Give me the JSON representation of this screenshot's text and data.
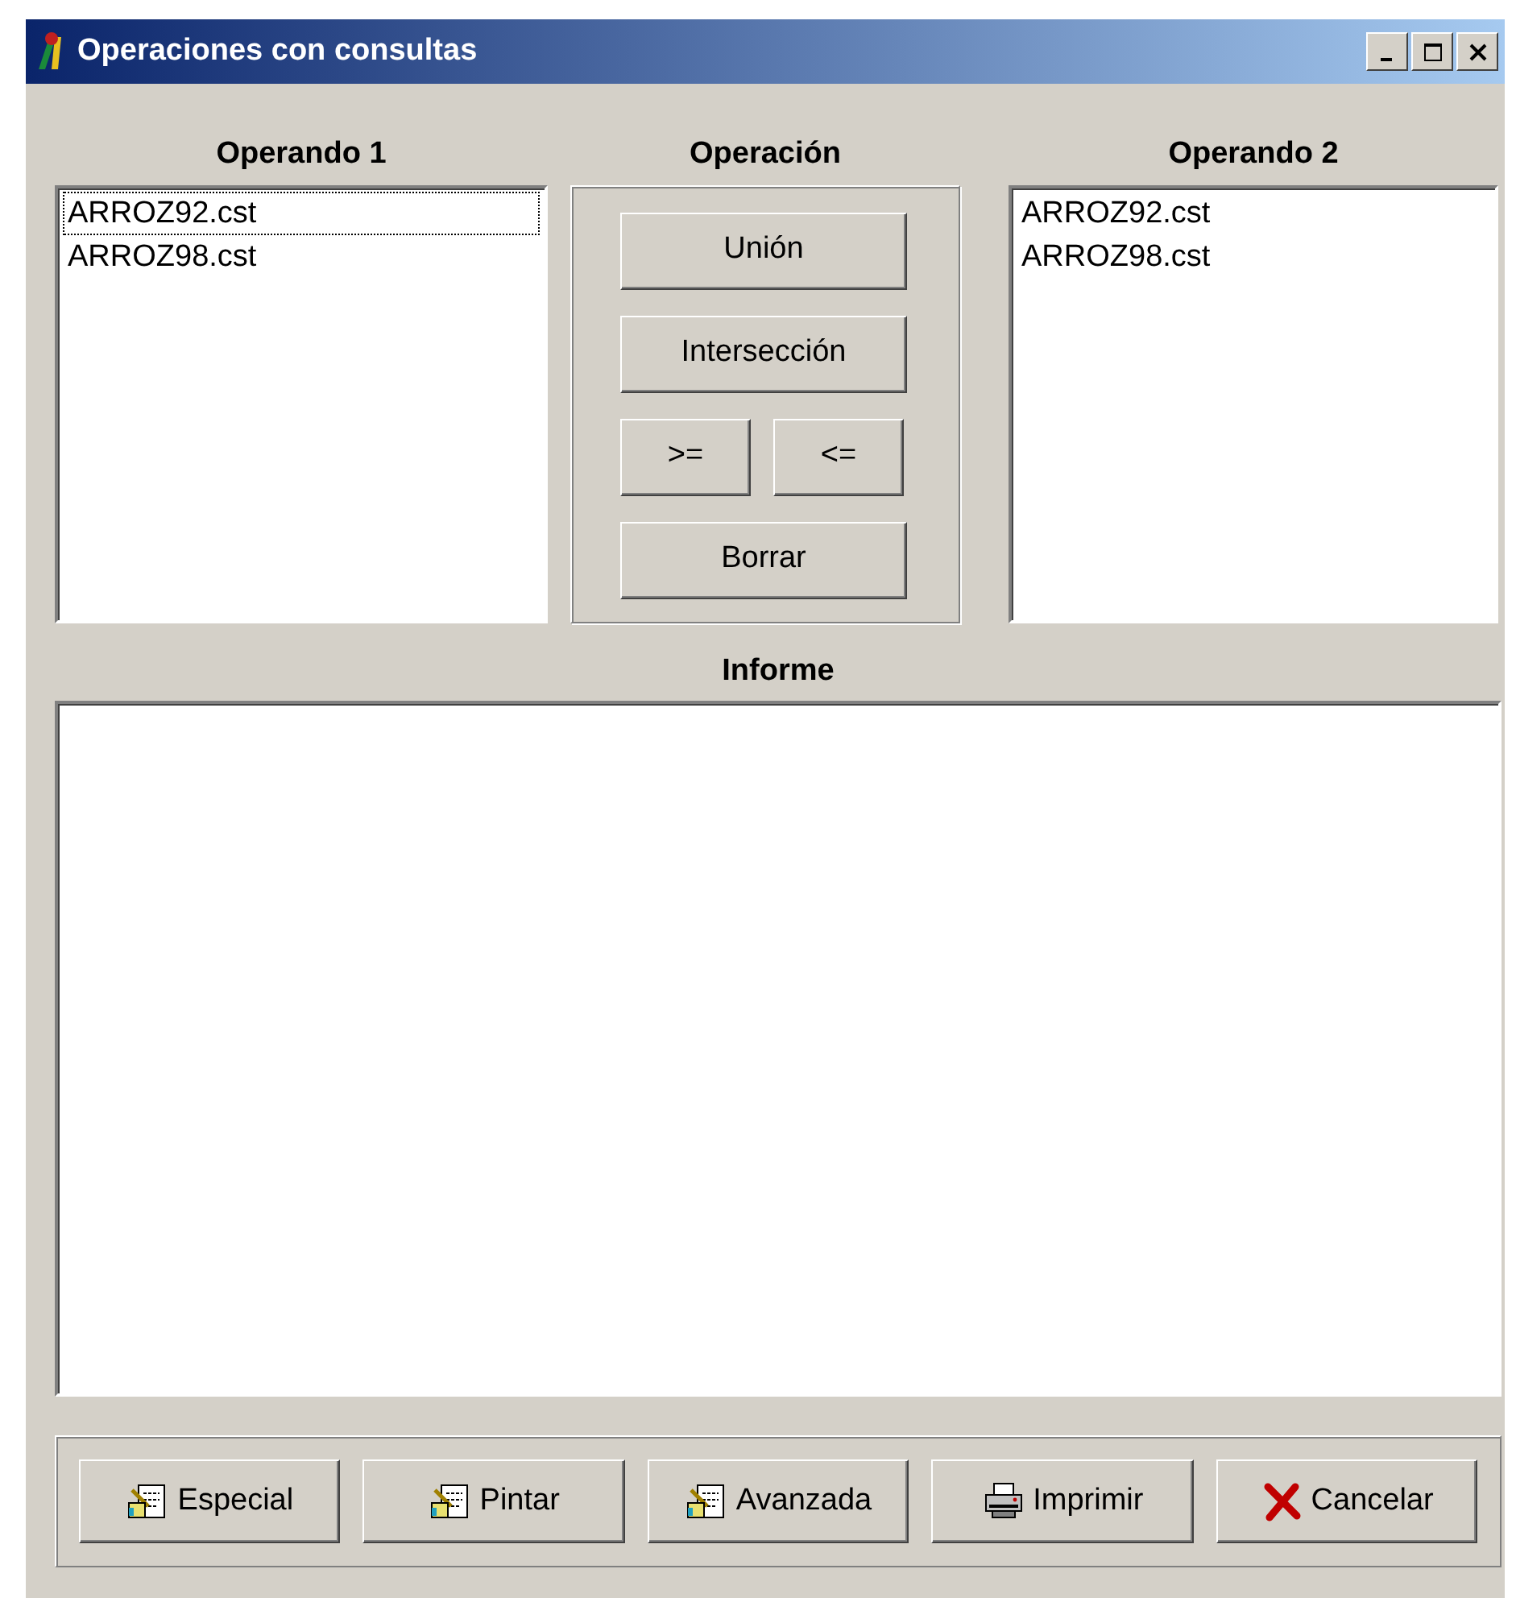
{
  "window": {
    "title": "Operaciones con consultas",
    "controls": [
      {
        "kind": "minimize"
      },
      {
        "kind": "maximize"
      },
      {
        "kind": "close"
      }
    ]
  },
  "operand_1": {
    "label": "Operando 1",
    "items": [
      {
        "text": "ARROZ92.cst",
        "focused": true
      },
      {
        "text": "ARROZ98.cst",
        "focused": false
      }
    ]
  },
  "operation": {
    "label": "Operación",
    "buttons": [
      {
        "label": "Unión",
        "kind": "wide"
      },
      {
        "label": "Intersección",
        "kind": "wide"
      },
      {
        "label": ">=",
        "kind": "half"
      },
      {
        "label": "<=",
        "kind": "half"
      },
      {
        "label": "Borrar",
        "kind": "wide"
      }
    ]
  },
  "operand_2": {
    "label": "Operando 2",
    "items": [
      {
        "text": "ARROZ92.cst",
        "focused": false
      },
      {
        "text": "ARROZ98.cst",
        "focused": false
      }
    ]
  },
  "report": {
    "label": "Informe"
  },
  "footer_buttons": [
    {
      "label": "Especial",
      "kind": "document"
    },
    {
      "label": "Pintar",
      "kind": "document"
    },
    {
      "label": "Avanzada",
      "kind": "document"
    },
    {
      "label": "Imprimir",
      "kind": "print"
    },
    {
      "label": "Cancelar",
      "kind": "cancel"
    }
  ]
}
